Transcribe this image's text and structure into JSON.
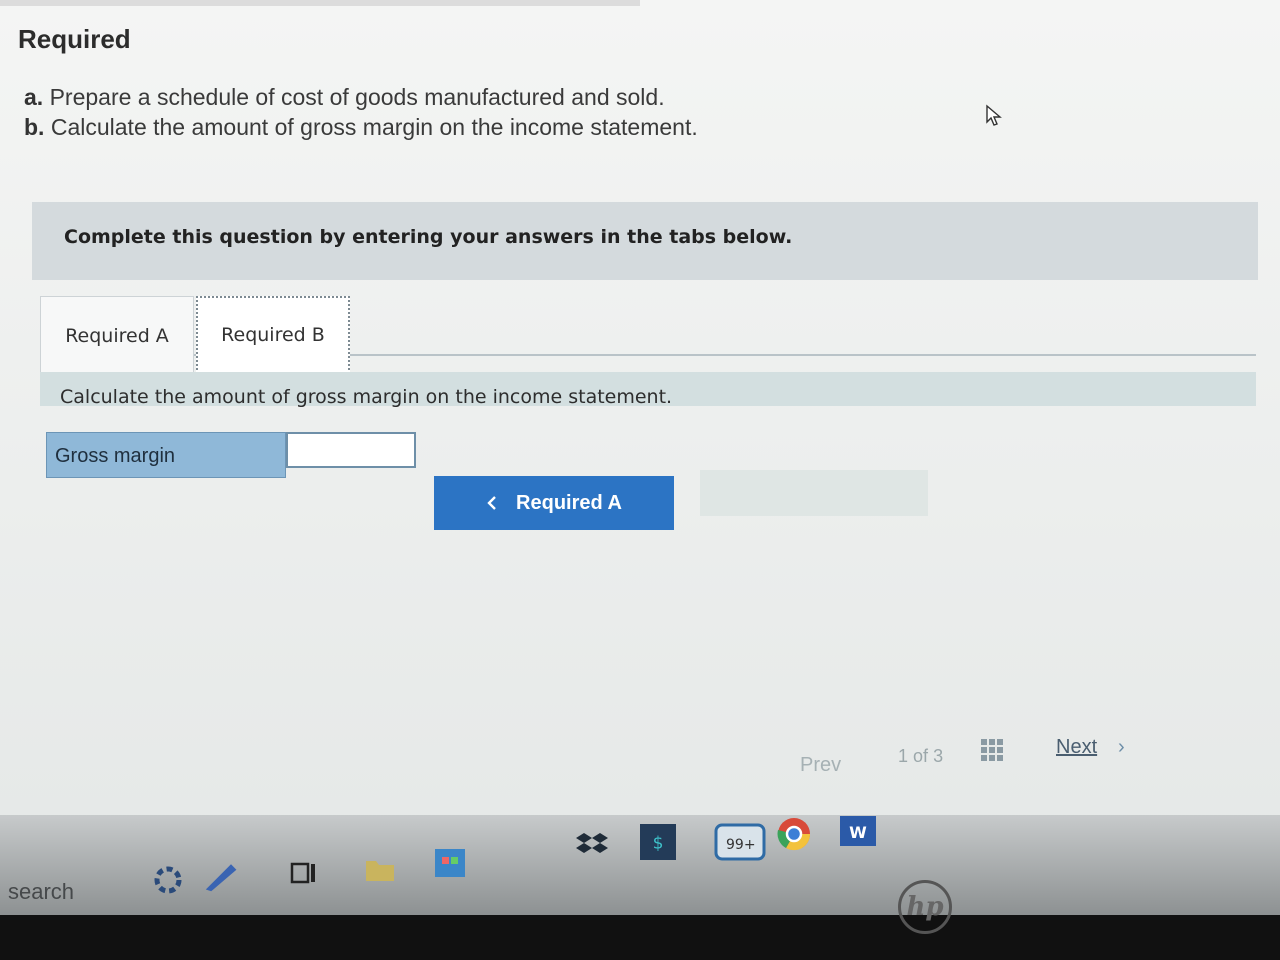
{
  "heading": "Required",
  "instructions": [
    {
      "letter": "a.",
      "text": "Prepare a schedule of cost of goods manufactured and sold."
    },
    {
      "letter": "b.",
      "text": "Calculate the amount of gross margin on the income statement."
    }
  ],
  "prompt": "Complete this question by entering your answers in the tabs below.",
  "tabs": [
    {
      "label": "Required A",
      "active": false
    },
    {
      "label": "Required B",
      "active": true
    }
  ],
  "panel_text": "Calculate the amount of gross margin on the income statement.",
  "gross_margin": {
    "label": "Gross margin",
    "value": ""
  },
  "nav_button": {
    "label": "Required A",
    "icon": "chevron-left-icon"
  },
  "pager": {
    "prev": "Prev",
    "current": "1",
    "of": "of",
    "total": "3",
    "next": "Next",
    "grid_icon": "grid-icon"
  },
  "taskbar": {
    "search": "search",
    "badge": "99+",
    "icons": [
      "cortana-icon",
      "pen-icon",
      "task-view-icon",
      "folder-icon",
      "store-icon",
      "dropbox-icon",
      "app-icon",
      "mail-icon",
      "chrome-icon",
      "word-icon"
    ]
  },
  "brand": "hp",
  "colors": {
    "accent": "#2c74c4",
    "label_bg": "#8fb8d8",
    "prompt_bg": "#d4dadd",
    "panel_bg": "#d3dfe0"
  }
}
